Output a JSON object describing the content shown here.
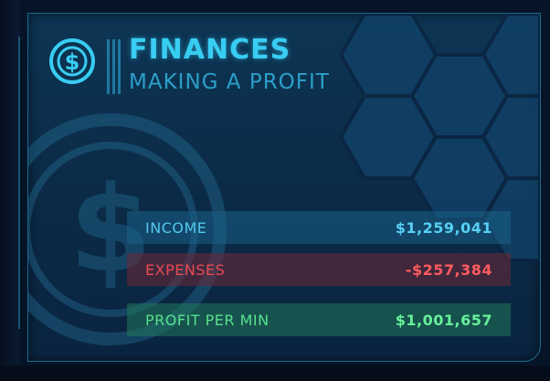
{
  "panel": {
    "title": "FINANCES",
    "subtitle": "MAKING A PROFIT",
    "rows": [
      {
        "label": "INCOME",
        "value": "$1,259,041",
        "color": "#57d0f5"
      },
      {
        "label": "EXPENSES",
        "value": "-$257,384",
        "color": "#ff5a5f"
      },
      {
        "label": "PROFIT PER MIN",
        "value": "$1,001,657",
        "color": "#66f09a"
      }
    ]
  },
  "icons": {
    "header": "dollar-coin-icon",
    "background": "dollar-watermark-icon"
  },
  "colors": {
    "accent": "#38cdf3",
    "panel_bg": "#0b2a46",
    "income": "#57d0f5",
    "expenses": "#ff5a5f",
    "profit": "#66f09a"
  }
}
